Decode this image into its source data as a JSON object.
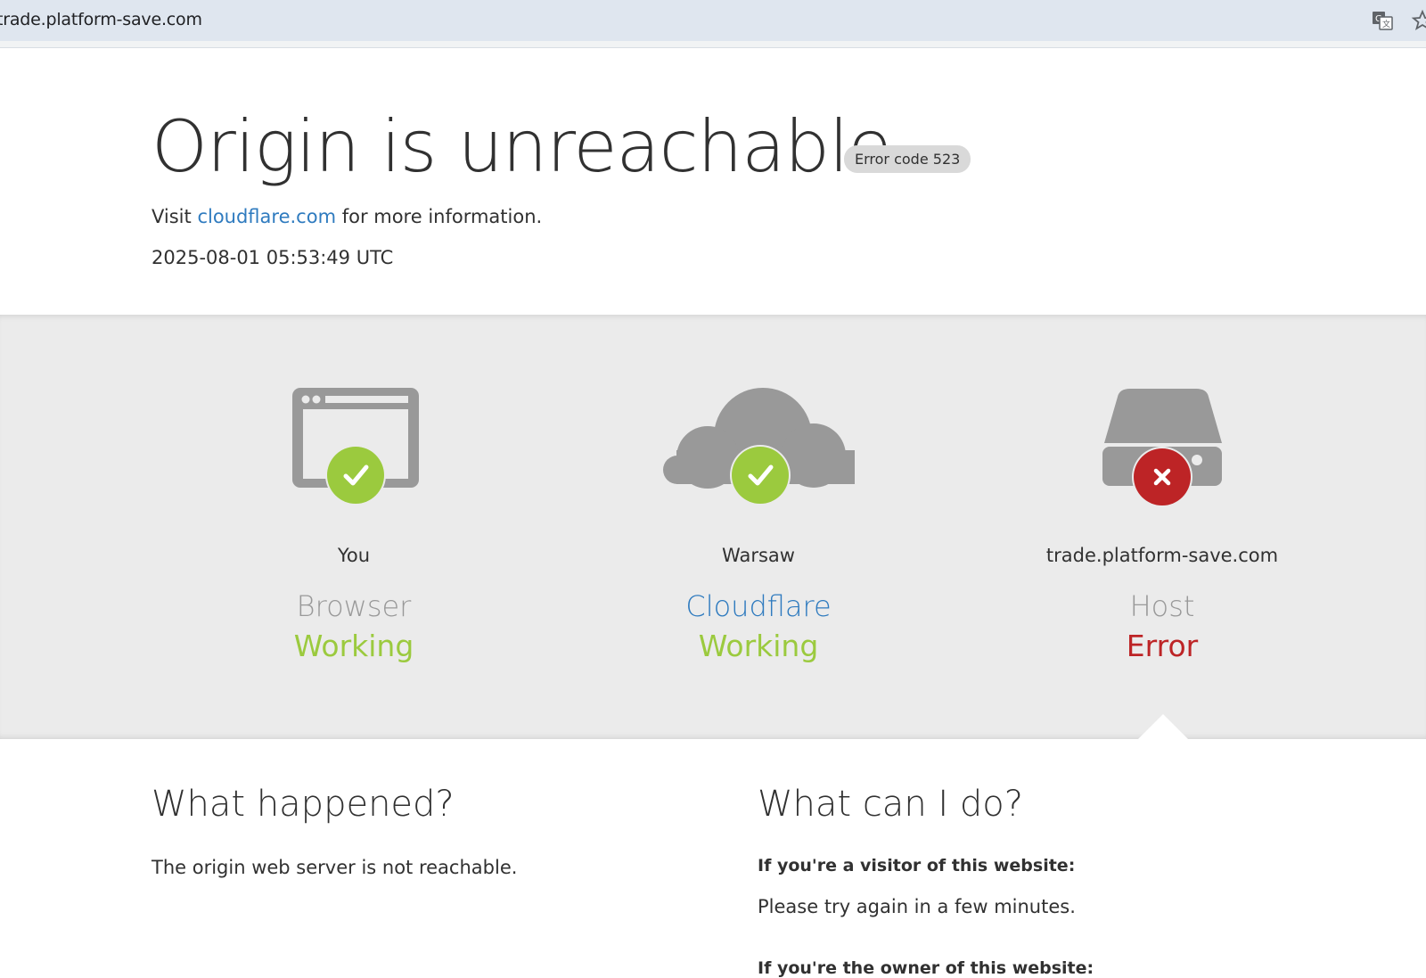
{
  "browser": {
    "url": "trade.platform-save.com",
    "icons": [
      "translate-icon",
      "star-icon"
    ]
  },
  "header": {
    "title": "Origin is unreachable",
    "error_badge": "Error code 523",
    "visit_prefix": "Visit ",
    "visit_link": "cloudflare.com",
    "visit_suffix": " for more information.",
    "timestamp": "2025-08-01 05:53:49 UTC"
  },
  "status": [
    {
      "location": "You",
      "what": "Browser",
      "status": "Working",
      "icon": "browser-icon",
      "badge": "check-icon"
    },
    {
      "location": "Warsaw",
      "what": "Cloudflare",
      "status": "Working",
      "icon": "cloud-icon",
      "badge": "check-icon"
    },
    {
      "location": "trade.platform-save.com",
      "what": "Host",
      "status": "Error",
      "icon": "server-icon",
      "badge": "error-x-icon"
    }
  ],
  "what_happened": {
    "heading": "What happened?",
    "text": "The origin web server is not reachable."
  },
  "what_can_i_do": {
    "heading": "What can I do?",
    "visitor_heading": "If you're a visitor of this website:",
    "visitor_text": "Please try again in a few minutes.",
    "owner_heading": "If you're the owner of this website:"
  },
  "colors": {
    "working": "#9bca3e",
    "error": "#bd2426",
    "link": "#2f7bbf",
    "icon_gray": "#999999",
    "band": "#ebebeb"
  }
}
